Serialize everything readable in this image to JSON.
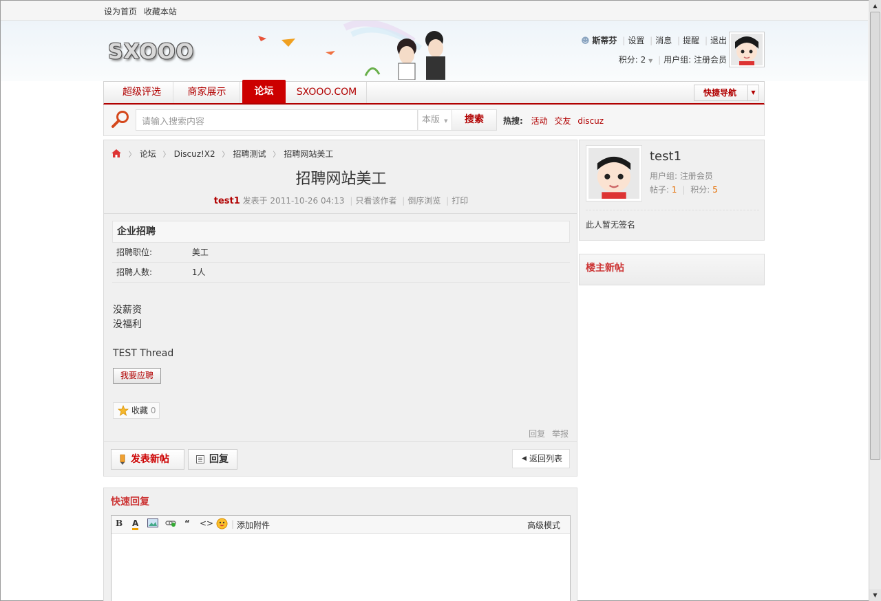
{
  "topbar": {
    "set_home": "设为首页",
    "bookmark": "收藏本站"
  },
  "header": {
    "logo_text": "SXOOO",
    "user_name": "斯蒂芬",
    "settings": "设置",
    "messages": "消息",
    "reminders": "提醒",
    "logout": "退出",
    "points_label": "积分: 2",
    "user_group": "用户组: 注册会员"
  },
  "nav": {
    "items": [
      {
        "label": "超级评选"
      },
      {
        "label": "商家展示"
      },
      {
        "label": "论坛"
      },
      {
        "label": "SXOOO.COM"
      }
    ],
    "active_index": 2,
    "quick_nav": "快捷导航"
  },
  "search": {
    "placeholder": "请输入搜索内容",
    "scope": "本版",
    "button": "搜索",
    "hot_label": "热搜:",
    "hot_keywords": [
      "活动",
      "交友",
      "discuz"
    ]
  },
  "breadcrumb": [
    "论坛",
    "Discuz!X2",
    "招聘测试",
    "招聘网站美工"
  ],
  "thread": {
    "title": "招聘网站美工",
    "author": "test1",
    "posted_at": "发表于 2011-10-26 04:13",
    "only_author": "只看该作者",
    "reverse": "倒序浏览",
    "print": "打印",
    "job_header": "企业招聘",
    "job_rows": [
      {
        "key": "招聘职位:",
        "value": "美工"
      },
      {
        "key": "招聘人数:",
        "value": "1人"
      }
    ],
    "body_lines": [
      "没薪资",
      "没福利",
      "",
      "TEST Thread"
    ],
    "apply": "我要应聘",
    "fav_label": "收藏",
    "fav_count": "0",
    "reply_link": "回复",
    "report_link": "举报",
    "new_thread": "发表新帖",
    "reply_button": "回复",
    "back_to_list": "返回列表"
  },
  "quick_reply": {
    "title": "快速回复",
    "attach": "添加附件",
    "advanced": "高级模式"
  },
  "sidebar": {
    "author_name": "test1",
    "group": "用户组: 注册会员",
    "posts_label": "帖子:",
    "posts_value": "1",
    "points_label": "积分:",
    "points_value": "5",
    "signature": "此人暂无签名",
    "new_posts_title": "楼主新帖"
  }
}
